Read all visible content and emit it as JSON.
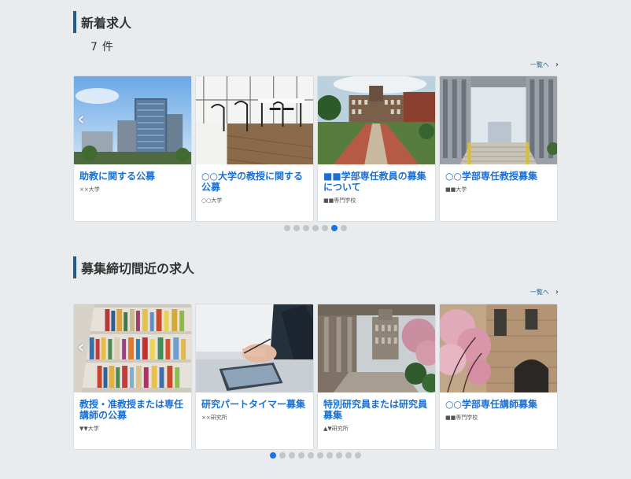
{
  "new_jobs": {
    "heading": "新着求人",
    "count_value": "7",
    "count_unit": "件",
    "more_label": "一覧へ",
    "cards": [
      {
        "title": "助教に関する公募",
        "org": "××大学"
      },
      {
        "title": "○○大学の教授に関する公募",
        "org": "○○大学"
      },
      {
        "title": "■■学部専任教員の募集について",
        "org": "■■専門学校"
      },
      {
        "title": "○○学部専任教授募集",
        "org": "■■大学"
      }
    ],
    "dots": {
      "total": 7,
      "active": 5
    }
  },
  "deadline_jobs": {
    "heading": "募集締切間近の求人",
    "more_label": "一覧へ",
    "cards": [
      {
        "title": "教授・准教授または専任講師の公募",
        "org": "▼▼大学"
      },
      {
        "title": "研究パートタイマー募集",
        "org": "××研究所"
      },
      {
        "title": "特別研究員または研究員募集",
        "org": "▲▼研究所"
      },
      {
        "title": "○○学部専任講師募集",
        "org": "■■専門学校"
      }
    ],
    "dots": {
      "total": 10,
      "active": 0
    }
  },
  "icons": {
    "more": "chevron-right-icon",
    "prev": "chevron-left-icon"
  },
  "colors": {
    "accent": "#1f5f85",
    "link": "#1a6fd1",
    "dot_active": "#1a73e8",
    "dot": "#c2c6ca",
    "background": "#e9ecee"
  }
}
